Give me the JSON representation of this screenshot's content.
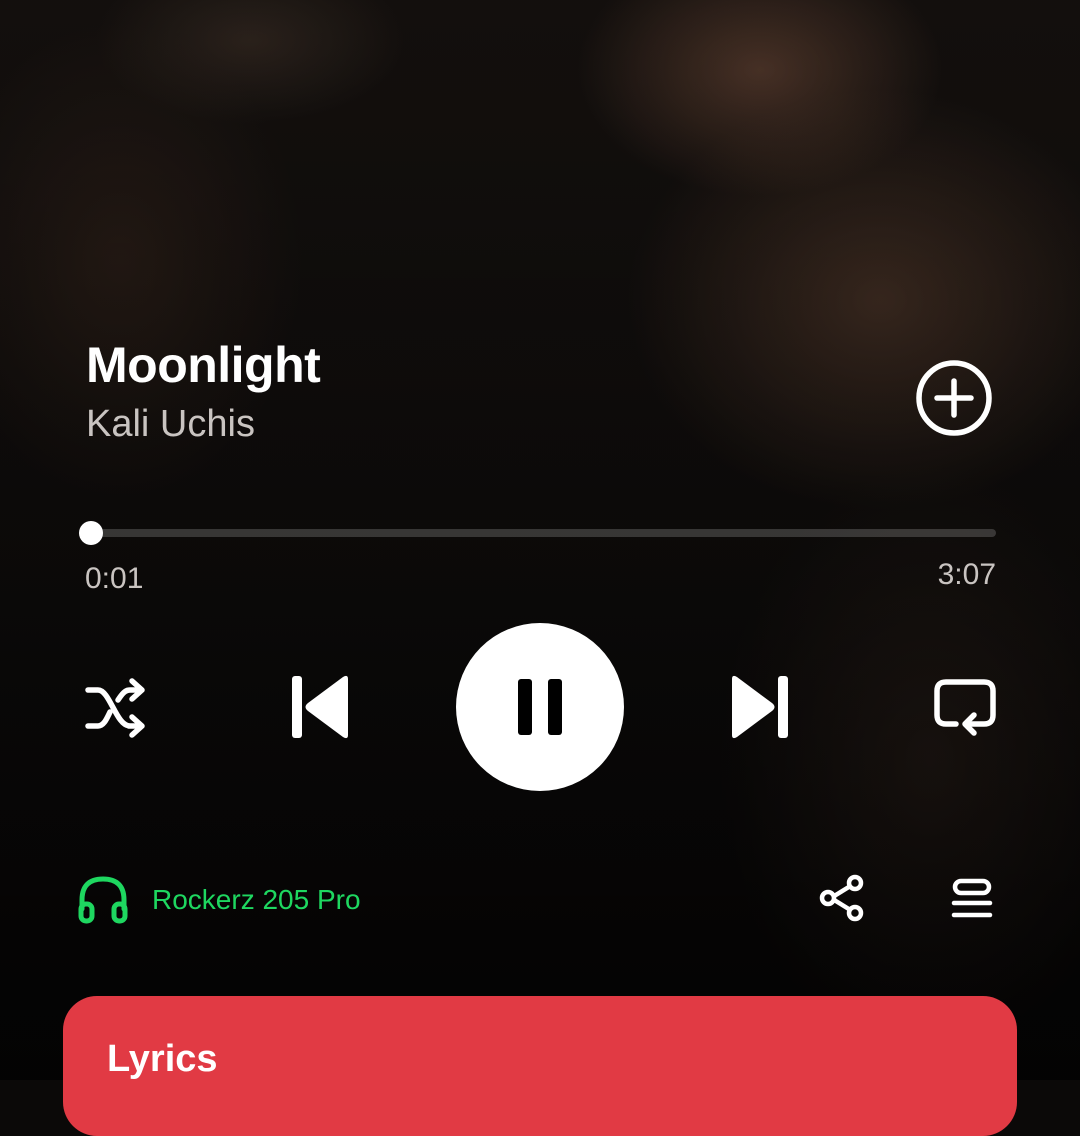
{
  "track": {
    "title": "Moonlight",
    "artist": "Kali Uchis"
  },
  "playback": {
    "elapsed": "0:01",
    "duration": "3:07",
    "progress_fraction": 0.005,
    "state": "playing"
  },
  "controls": {
    "add_icon": "plus-circle-icon",
    "shuffle_icon": "shuffle-icon",
    "previous_icon": "skip-previous-icon",
    "pause_icon": "pause-icon",
    "next_icon": "skip-next-icon",
    "repeat_icon": "repeat-icon",
    "share_icon": "share-icon",
    "queue_icon": "queue-icon"
  },
  "device": {
    "name": "Rockerz 205 Pro",
    "icon": "headphones-icon",
    "color": "#1ed760"
  },
  "lyrics": {
    "label": "Lyrics",
    "color": "#e13a44"
  }
}
